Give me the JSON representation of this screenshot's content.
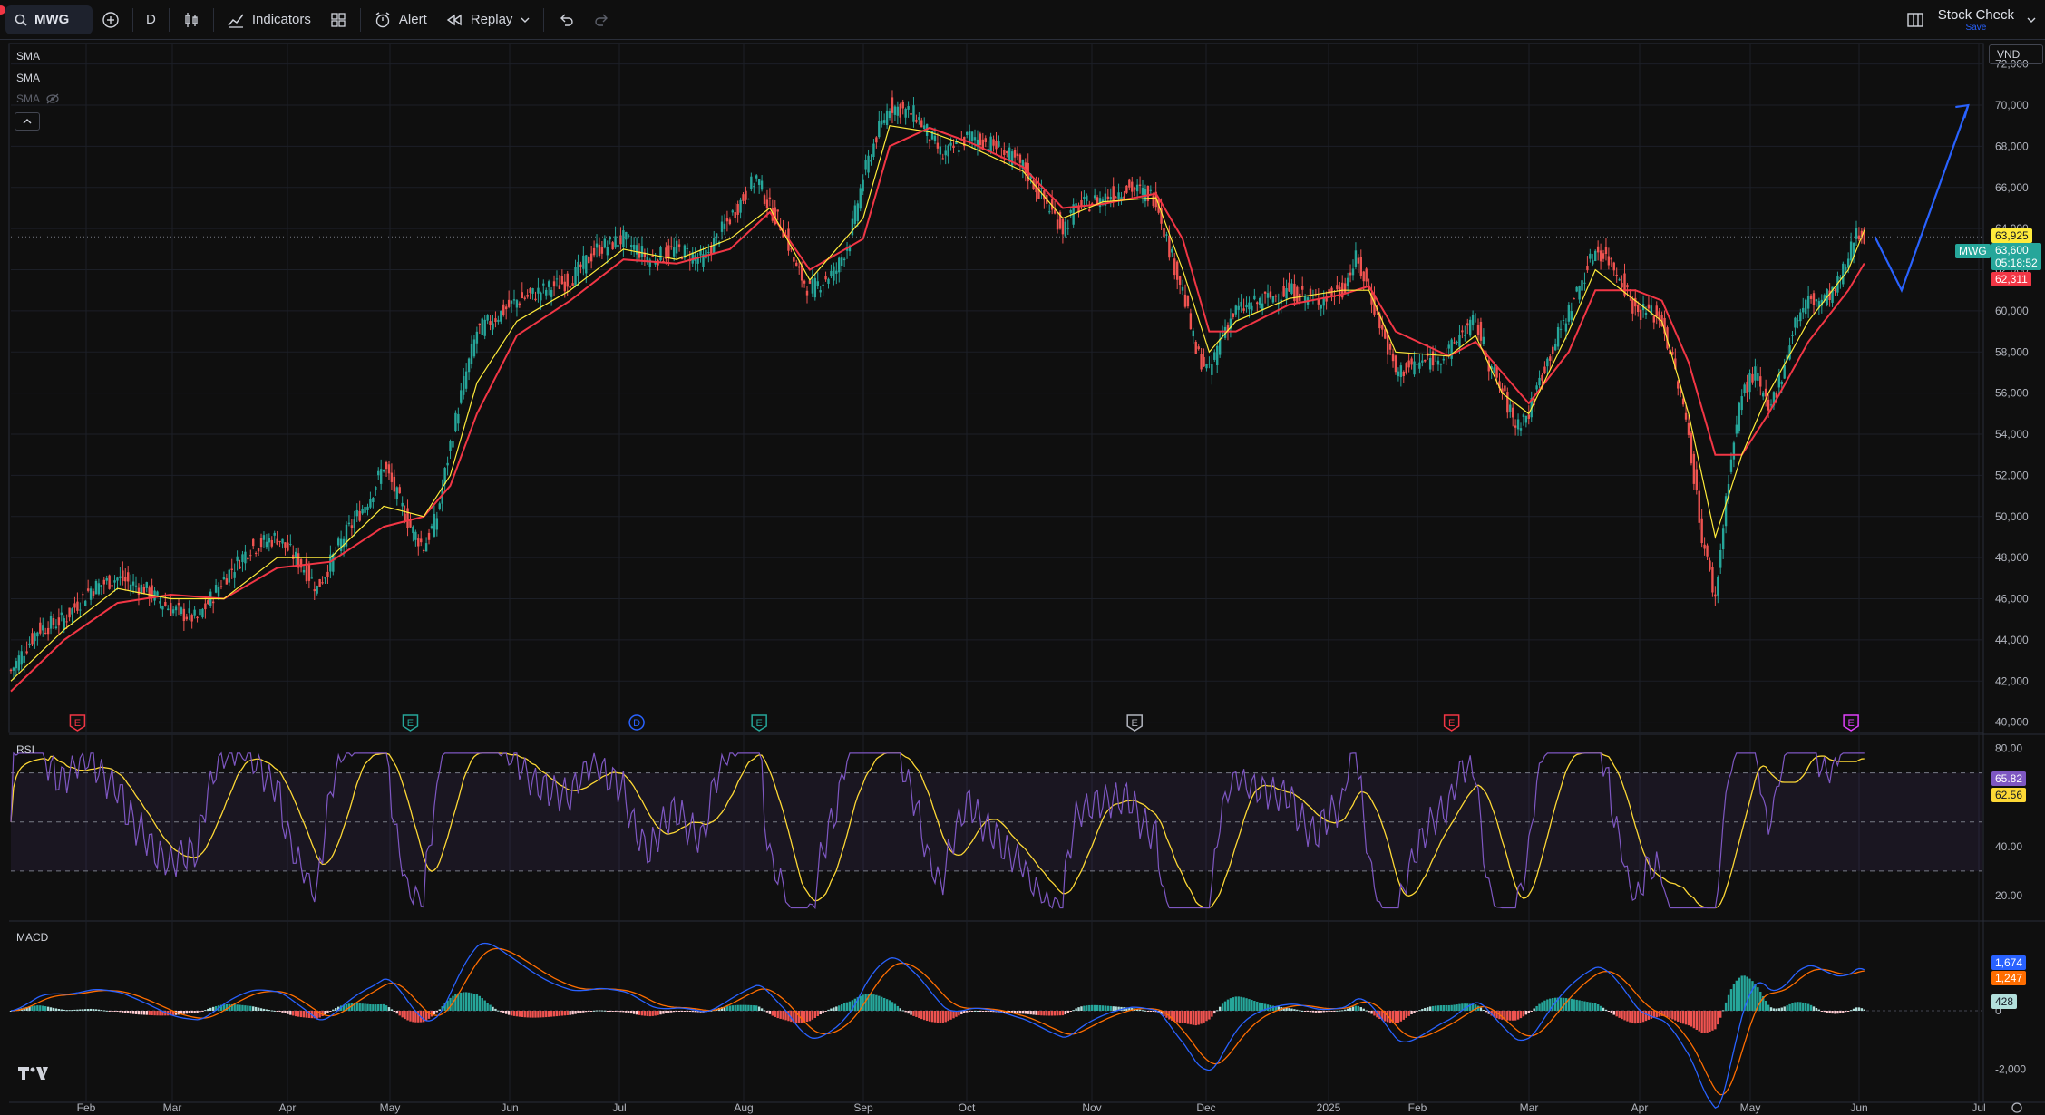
{
  "toolbar": {
    "symbol": "MWG",
    "interval": "D",
    "indicators_label": "Indicators",
    "alert_label": "Alert",
    "replay_label": "Replay",
    "layout_name": "Stock Check",
    "layout_sub": "Save"
  },
  "legend": {
    "sma1": "SMA",
    "sma2": "SMA",
    "sma3": "SMA"
  },
  "currency": "VND",
  "panes": {
    "rsi_title": "RSI",
    "macd_title": "MACD"
  },
  "price_tags": {
    "sma_fast": "63,925",
    "symbol": "MWG",
    "last": "63,600",
    "countdown": "05:18:52",
    "sma_slow": "62,311",
    "rsi": "65.82",
    "rsi_ma": "62.56",
    "macd": "1,674",
    "signal": "1,247",
    "hist": "428"
  },
  "colors": {
    "up": "#26a69a",
    "down": "#ef5350",
    "sma_fast": "#ffeb3b",
    "sma_slow": "#f23645",
    "rsi": "#7e57c2",
    "rsi_ma": "#fdd835",
    "macd": "#2962ff",
    "signal": "#ff6d00",
    "projection": "#2962ff"
  },
  "chart_data": {
    "type": "candlestick",
    "y_axis_ticks": [
      "72,000",
      "70,000",
      "68,000",
      "66,000",
      "64,000",
      "62,000",
      "60,000",
      "58,000",
      "56,000",
      "54,000",
      "52,000",
      "50,000",
      "48,000",
      "46,000",
      "44,000",
      "42,000",
      "40,000"
    ],
    "ylim": [
      39500,
      73000
    ],
    "x_axis_ticks": [
      "Feb",
      "Mar",
      "Apr",
      "May",
      "Jun",
      "Jul",
      "Aug",
      "Sep",
      "Oct",
      "Nov",
      "Dec",
      "2025",
      "Feb",
      "Mar",
      "Apr",
      "May",
      "Jun",
      "Jul"
    ],
    "close_path": [
      [
        0,
        42500
      ],
      [
        10,
        44500
      ],
      [
        20,
        45000
      ],
      [
        30,
        46500
      ],
      [
        40,
        47000
      ],
      [
        50,
        46500
      ],
      [
        60,
        45500
      ],
      [
        70,
        45000
      ],
      [
        80,
        47000
      ],
      [
        90,
        48500
      ],
      [
        100,
        49000
      ],
      [
        110,
        47500
      ],
      [
        115,
        46500
      ],
      [
        125,
        49000
      ],
      [
        135,
        51000
      ],
      [
        140,
        52500
      ],
      [
        145,
        51000
      ],
      [
        150,
        49500
      ],
      [
        155,
        48500
      ],
      [
        160,
        50000
      ],
      [
        165,
        53500
      ],
      [
        170,
        56500
      ],
      [
        175,
        59000
      ],
      [
        180,
        59500
      ],
      [
        190,
        60500
      ],
      [
        200,
        61000
      ],
      [
        210,
        61500
      ],
      [
        220,
        63000
      ],
      [
        230,
        63500
      ],
      [
        240,
        62500
      ],
      [
        250,
        63000
      ],
      [
        260,
        62500
      ],
      [
        270,
        64500
      ],
      [
        280,
        66500
      ],
      [
        285,
        65000
      ],
      [
        290,
        64000
      ],
      [
        295,
        62000
      ],
      [
        300,
        61000
      ],
      [
        310,
        62000
      ],
      [
        315,
        63500
      ],
      [
        320,
        66500
      ],
      [
        325,
        68500
      ],
      [
        330,
        70000
      ],
      [
        340,
        69500
      ],
      [
        345,
        68500
      ],
      [
        350,
        67500
      ],
      [
        360,
        68500
      ],
      [
        370,
        68000
      ],
      [
        380,
        67000
      ],
      [
        390,
        65000
      ],
      [
        395,
        64000
      ],
      [
        400,
        65000
      ],
      [
        410,
        65500
      ],
      [
        420,
        66000
      ],
      [
        430,
        65500
      ],
      [
        435,
        63000
      ],
      [
        440,
        61000
      ],
      [
        445,
        58000
      ],
      [
        450,
        57000
      ],
      [
        455,
        59000
      ],
      [
        460,
        60000
      ],
      [
        470,
        60500
      ],
      [
        480,
        61000
      ],
      [
        490,
        60500
      ],
      [
        500,
        61000
      ],
      [
        505,
        62500
      ],
      [
        510,
        61000
      ],
      [
        515,
        59000
      ],
      [
        520,
        57000
      ],
      [
        530,
        57500
      ],
      [
        540,
        58000
      ],
      [
        545,
        59000
      ],
      [
        550,
        59500
      ],
      [
        555,
        57500
      ],
      [
        560,
        56000
      ],
      [
        565,
        54500
      ],
      [
        570,
        55000
      ],
      [
        575,
        57000
      ],
      [
        580,
        58500
      ],
      [
        585,
        60000
      ],
      [
        590,
        61500
      ],
      [
        595,
        63000
      ],
      [
        600,
        62500
      ],
      [
        605,
        61500
      ],
      [
        610,
        60000
      ],
      [
        615,
        60000
      ],
      [
        620,
        59500
      ],
      [
        625,
        57000
      ],
      [
        630,
        54000
      ],
      [
        635,
        49000
      ],
      [
        640,
        46000
      ],
      [
        645,
        52000
      ],
      [
        650,
        56000
      ],
      [
        655,
        57000
      ],
      [
        660,
        55000
      ],
      [
        665,
        57000
      ],
      [
        670,
        59500
      ],
      [
        675,
        60500
      ],
      [
        680,
        60500
      ],
      [
        685,
        61000
      ],
      [
        690,
        62500
      ],
      [
        693,
        64000
      ],
      [
        696,
        63600
      ]
    ],
    "sma_fast_path": [
      [
        0,
        42000
      ],
      [
        20,
        44500
      ],
      [
        40,
        46500
      ],
      [
        60,
        46000
      ],
      [
        80,
        46000
      ],
      [
        100,
        48000
      ],
      [
        120,
        48000
      ],
      [
        140,
        50500
      ],
      [
        155,
        50000
      ],
      [
        165,
        52000
      ],
      [
        175,
        56500
      ],
      [
        190,
        59500
      ],
      [
        210,
        61000
      ],
      [
        230,
        63000
      ],
      [
        250,
        62500
      ],
      [
        270,
        63500
      ],
      [
        285,
        65000
      ],
      [
        300,
        61500
      ],
      [
        320,
        64500
      ],
      [
        330,
        69000
      ],
      [
        345,
        68700
      ],
      [
        360,
        68000
      ],
      [
        380,
        66800
      ],
      [
        395,
        64500
      ],
      [
        410,
        65300
      ],
      [
        430,
        65500
      ],
      [
        440,
        62000
      ],
      [
        450,
        58000
      ],
      [
        460,
        59500
      ],
      [
        480,
        60600
      ],
      [
        500,
        61000
      ],
      [
        510,
        61000
      ],
      [
        520,
        58000
      ],
      [
        540,
        57800
      ],
      [
        550,
        58800
      ],
      [
        560,
        56000
      ],
      [
        570,
        55000
      ],
      [
        585,
        59000
      ],
      [
        595,
        62000
      ],
      [
        610,
        60500
      ],
      [
        620,
        59500
      ],
      [
        630,
        55000
      ],
      [
        640,
        49000
      ],
      [
        650,
        53000
      ],
      [
        660,
        56000
      ],
      [
        675,
        59500
      ],
      [
        690,
        62000
      ],
      [
        696,
        63925
      ]
    ],
    "sma_slow_path": [
      [
        0,
        41500
      ],
      [
        20,
        44000
      ],
      [
        40,
        45800
      ],
      [
        60,
        46200
      ],
      [
        80,
        46000
      ],
      [
        100,
        47500
      ],
      [
        120,
        47800
      ],
      [
        140,
        49500
      ],
      [
        155,
        50000
      ],
      [
        165,
        51500
      ],
      [
        175,
        55000
      ],
      [
        190,
        58800
      ],
      [
        210,
        60500
      ],
      [
        230,
        62500
      ],
      [
        250,
        62300
      ],
      [
        270,
        63000
      ],
      [
        285,
        64800
      ],
      [
        300,
        62000
      ],
      [
        320,
        63500
      ],
      [
        330,
        68000
      ],
      [
        345,
        68900
      ],
      [
        360,
        68200
      ],
      [
        380,
        67000
      ],
      [
        395,
        65000
      ],
      [
        410,
        65200
      ],
      [
        430,
        65700
      ],
      [
        440,
        63500
      ],
      [
        450,
        59000
      ],
      [
        460,
        59000
      ],
      [
        480,
        60300
      ],
      [
        500,
        60800
      ],
      [
        510,
        61200
      ],
      [
        520,
        59000
      ],
      [
        540,
        57800
      ],
      [
        550,
        58500
      ],
      [
        560,
        57000
      ],
      [
        570,
        55500
      ],
      [
        585,
        58000
      ],
      [
        595,
        61000
      ],
      [
        610,
        61000
      ],
      [
        620,
        60500
      ],
      [
        630,
        57500
      ],
      [
        640,
        53000
      ],
      [
        650,
        53000
      ],
      [
        660,
        55000
      ],
      [
        675,
        58500
      ],
      [
        690,
        61000
      ],
      [
        696,
        62311
      ]
    ],
    "projection_path": [
      [
        700,
        63600
      ],
      [
        710,
        61000
      ],
      [
        735,
        70000
      ]
    ],
    "rsi": {
      "ylim": [
        10,
        85
      ],
      "ticks": [
        "80.00",
        "40.00",
        "20.00"
      ],
      "bands": [
        70,
        30
      ],
      "mid": 50
    },
    "macd": {
      "ticks": [
        "0",
        "-2,000"
      ],
      "ylim": [
        -3000,
        3000
      ]
    },
    "event_markers": [
      {
        "label": "E",
        "x": 25,
        "color": "#f23645"
      },
      {
        "label": "E",
        "x": 150,
        "color": "#26a69a"
      },
      {
        "label": "D",
        "x": 235,
        "color": "#2962ff"
      },
      {
        "label": "E",
        "x": 281,
        "color": "#26a69a"
      },
      {
        "label": "E",
        "x": 422,
        "color": "#b2b5be"
      },
      {
        "label": "E",
        "x": 541,
        "color": "#f23645"
      },
      {
        "label": "E",
        "x": 691,
        "color": "#e040fb"
      }
    ]
  }
}
